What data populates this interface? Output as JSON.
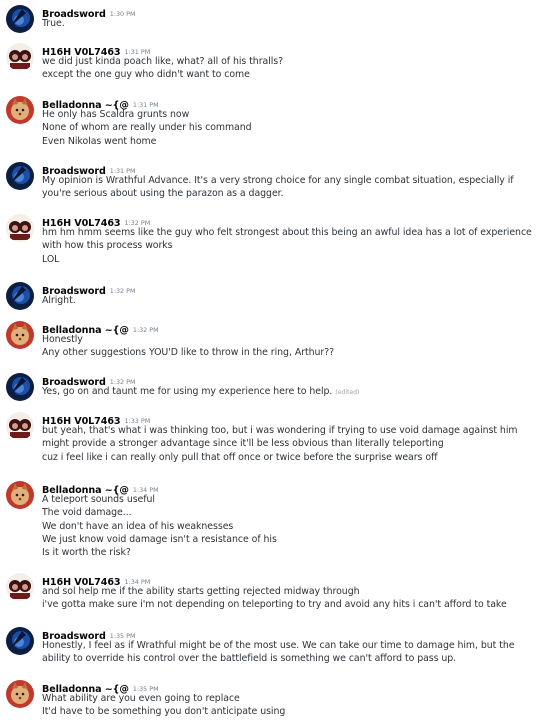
{
  "messages": [
    {
      "author": "Broadsword",
      "avatar": "broadsword-avatar",
      "time": "1:30 PM",
      "lines": [
        "True."
      ]
    },
    {
      "author": "H16H V0L7463",
      "avatar": "highvoltage-avatar",
      "time": "1:31 PM",
      "lines": [
        "we did just kinda poach like, what? all of his thralls?",
        "except the one guy who didn't want to come"
      ]
    },
    {
      "author": "Belladonna ~{@",
      "avatar": "belladonna-avatar",
      "time": "1:31 PM",
      "lines": [
        "He only has Scaldra grunts now",
        "None of whom are really under his command",
        "Even Nikolas went home"
      ]
    },
    {
      "author": "Broadsword",
      "avatar": "broadsword-avatar",
      "time": "1:31 PM",
      "lines": [
        "My opinion is Wrathful Advance. It's a very strong choice for any single combat situation, especially if you're serious about using the parazon as a dagger."
      ]
    },
    {
      "author": "H16H V0L7463",
      "avatar": "highvoltage-avatar",
      "time": "1:32 PM",
      "lines": [
        "hm hm hmm seems like the guy who felt strongest about this being an awful idea has a lot of experience with how this process works",
        "LOL"
      ]
    },
    {
      "author": "Broadsword",
      "avatar": "broadsword-avatar",
      "time": "1:32 PM",
      "lines": [
        "Alright."
      ]
    },
    {
      "author": "Belladonna ~{@",
      "avatar": "belladonna-avatar",
      "time": "1:32 PM",
      "lines": [
        "Honestly",
        "Any other suggestions YOU'D like to throw in the ring, Arthur??"
      ]
    },
    {
      "author": "Broadsword",
      "avatar": "broadsword-avatar",
      "time": "1:32 PM",
      "lines": [
        "Yes, go on and taunt me for using my experience here to help."
      ],
      "edited": "(edited)"
    },
    {
      "author": "H16H V0L7463",
      "avatar": "highvoltage-avatar",
      "time": "1:33 PM",
      "lines": [
        "but yeah, that's what i was thinking too, but i was wondering if trying to use void damage against him might provide a stronger advantage since it'll be less obvious than literally teleporting",
        "cuz i feel like i can really only pull that off once or twice before the surprise wears off"
      ]
    },
    {
      "author": "Belladonna ~{@",
      "avatar": "belladonna-avatar",
      "time": "1:34 PM",
      "lines": [
        "A teleport sounds useful",
        "The void damage...",
        "We don't have an idea of his weaknesses",
        "We just know void damage isn't a resistance of his",
        "Is it worth the risk?"
      ]
    },
    {
      "author": "H16H V0L7463",
      "avatar": "highvoltage-avatar",
      "time": "1:34 PM",
      "lines": [
        "and sol help me if the ability starts getting rejected midway through",
        "i've gotta make sure i'm not depending on teleporting to try and avoid any hits i can't afford to take"
      ]
    },
    {
      "author": "Broadsword",
      "avatar": "broadsword-avatar",
      "time": "1:35 PM",
      "lines": [
        "Honestly, I feel as if Wrathful might be of the most use. We can take our time to damage him, but the ability to override his control over the battlefield is something we can't afford to pass up."
      ]
    },
    {
      "author": "Belladonna ~{@",
      "avatar": "belladonna-avatar",
      "time": "1:35 PM",
      "lines": [
        "What ability are you even going to replace",
        "It'd have to be something you don't anticipate using"
      ]
    }
  ]
}
